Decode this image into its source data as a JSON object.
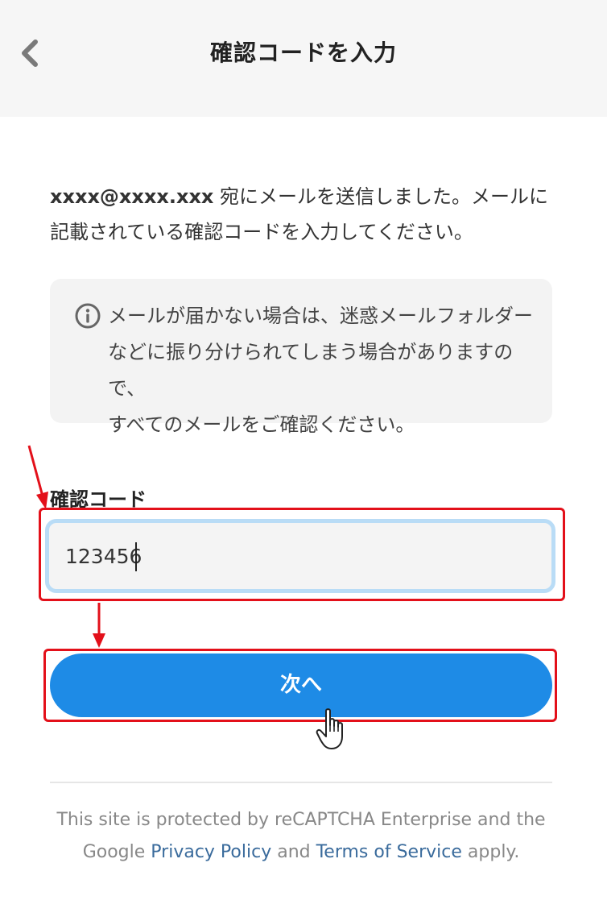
{
  "header": {
    "title": "確認コードを入力",
    "back_icon": "chevron-left-icon"
  },
  "message": {
    "email": "xxxx@xxxx.xxx",
    "text": " 宛にメールを送信しました。メールに記載されている確認コードを入力してください。"
  },
  "info": {
    "icon": "info-circle-icon",
    "line1": "メールが届かない場合は、迷惑メールフォルダー",
    "line2": "などに振り分けられてしまう場合がありますので、",
    "line3": "すべてのメールをご確認ください。"
  },
  "form": {
    "label": "確認コード",
    "value": "123456",
    "submit_label": "次へ"
  },
  "footer": {
    "line1": "This site is protected by reCAPTCHA Enterprise and the",
    "google": "Google",
    "privacy_link": "Privacy Policy",
    "and": "and",
    "terms_link": "Terms of Service",
    "apply": "apply."
  },
  "colors": {
    "header_bg": "#f6f6f6",
    "primary": "#1e8be6",
    "annotation_red": "#e3101a",
    "input_focus_border": "#b9dcf6",
    "link": "#3a6b9c"
  }
}
